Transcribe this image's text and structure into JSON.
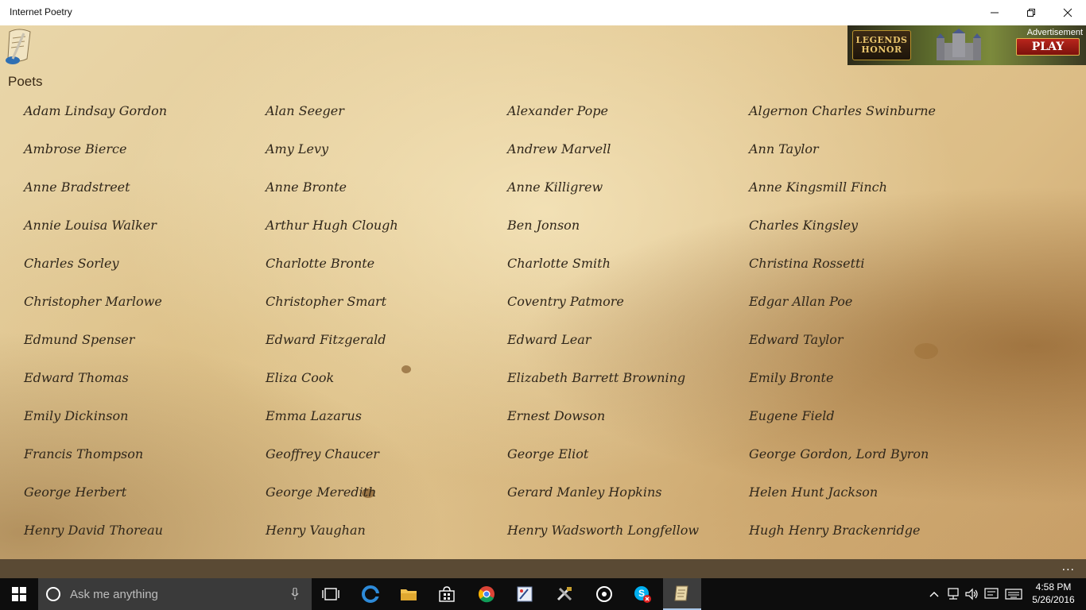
{
  "window": {
    "title": "Internet Poetry"
  },
  "section_title": "Poets",
  "ad": {
    "label": "Advertisement",
    "brand_line1": "LEGENDS",
    "brand_line2": "HONOR",
    "cta": "PLAY"
  },
  "poets": [
    "Adam Lindsay Gordon",
    "Alan Seeger",
    "Alexander Pope",
    "Algernon Charles Swinburne",
    "Ambrose Bierce",
    "Amy Levy",
    "Andrew Marvell",
    "Ann Taylor",
    "Anne Bradstreet",
    "Anne Bronte",
    "Anne Killigrew",
    "Anne Kingsmill Finch",
    "Annie Louisa Walker",
    "Arthur Hugh Clough",
    "Ben Jonson",
    "Charles Kingsley",
    "Charles Sorley",
    "Charlotte Bronte",
    "Charlotte Smith",
    "Christina Rossetti",
    "Christopher Marlowe",
    "Christopher Smart",
    "Coventry Patmore",
    "Edgar Allan Poe",
    "Edmund Spenser",
    "Edward Fitzgerald",
    "Edward Lear",
    "Edward Taylor",
    "Edward Thomas",
    "Eliza Cook",
    "Elizabeth Barrett Browning",
    "Emily Bronte",
    "Emily Dickinson",
    "Emma Lazarus",
    "Ernest Dowson",
    "Eugene Field",
    "Francis Thompson",
    "Geoffrey Chaucer",
    "George Eliot",
    "George Gordon, Lord Byron",
    "George Herbert",
    "George Meredith",
    "Gerard Manley Hopkins",
    "Helen Hunt Jackson",
    "Henry David Thoreau",
    "Henry Vaughan",
    "Henry Wadsworth Longfellow",
    "Hugh Henry Brackenridge"
  ],
  "appbar": {
    "more": "..."
  },
  "taskbar": {
    "search_placeholder": "Ask me anything",
    "time": "4:58 PM",
    "date": "5/26/2016"
  }
}
